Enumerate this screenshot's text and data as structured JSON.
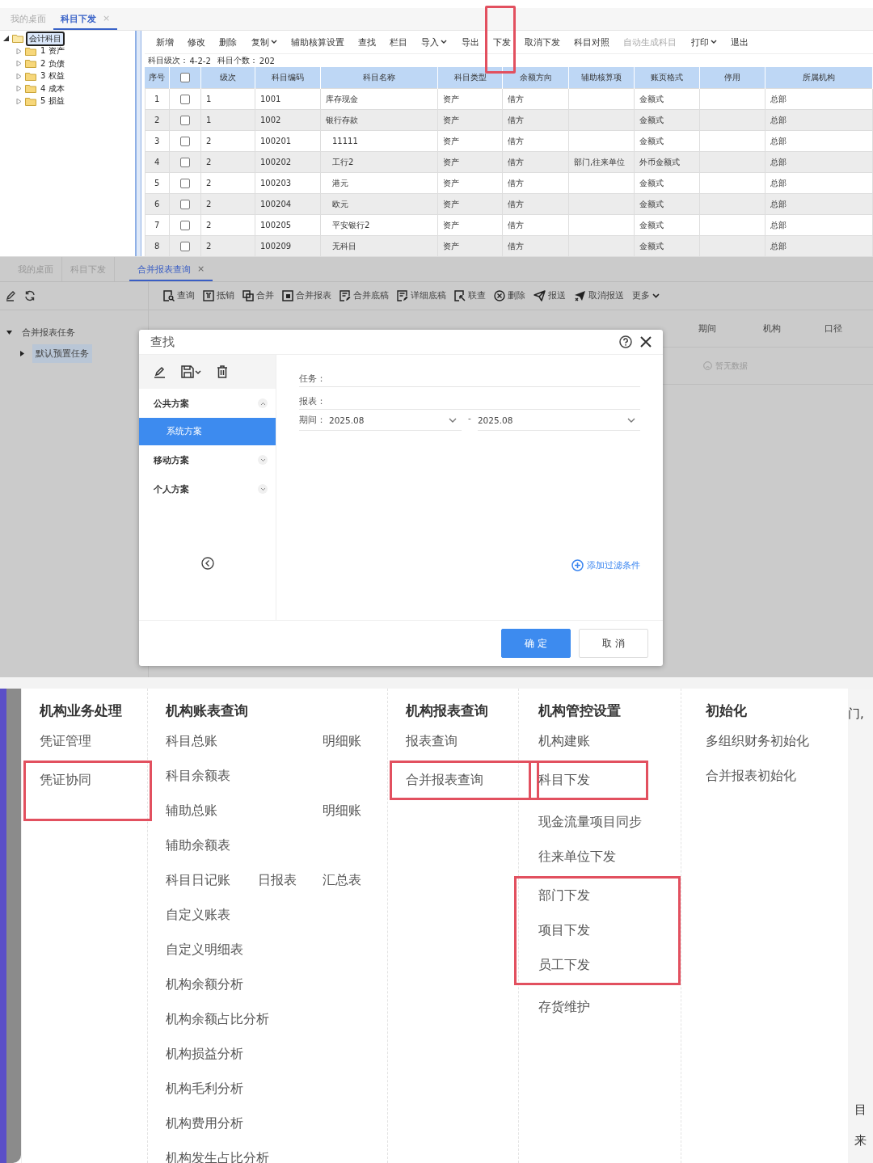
{
  "subject_issue_screen": {
    "tabs": [
      {
        "label": "我的桌面",
        "selected": false,
        "closable": false
      },
      {
        "label": "科目下发",
        "selected": true,
        "closable": true
      }
    ],
    "close_mark": "×",
    "tree": {
      "label": "会计科目",
      "expanded": true,
      "selected": true,
      "children": [
        {
          "label": "1 资产",
          "expanded": false
        },
        {
          "label": "2 负债",
          "expanded": false
        },
        {
          "label": "3 权益",
          "expanded": false
        },
        {
          "label": "4 成本",
          "expanded": false
        },
        {
          "label": "5 损益",
          "expanded": false
        }
      ]
    },
    "toolbar": [
      {
        "label": "新增",
        "dropdown": false,
        "disabled": false,
        "highlighted": false
      },
      {
        "label": "修改",
        "dropdown": false,
        "disabled": false,
        "highlighted": false
      },
      {
        "label": "删除",
        "dropdown": false,
        "disabled": false,
        "highlighted": false
      },
      {
        "label": "复制",
        "dropdown": true,
        "disabled": false,
        "highlighted": false
      },
      {
        "label": "辅助核算设置",
        "dropdown": false,
        "disabled": false,
        "highlighted": false
      },
      {
        "label": "查找",
        "dropdown": false,
        "disabled": false,
        "highlighted": false
      },
      {
        "label": "栏目",
        "dropdown": false,
        "disabled": false,
        "highlighted": false
      },
      {
        "label": "导入",
        "dropdown": true,
        "disabled": false,
        "highlighted": false
      },
      {
        "label": "导出",
        "dropdown": false,
        "disabled": false,
        "highlighted": false
      },
      {
        "label": "下发",
        "dropdown": false,
        "disabled": false,
        "highlighted": true
      },
      {
        "label": "取消下发",
        "dropdown": false,
        "disabled": false,
        "highlighted": false
      },
      {
        "label": "科目对照",
        "dropdown": false,
        "disabled": false,
        "highlighted": false
      },
      {
        "label": "自动生成科目",
        "dropdown": false,
        "disabled": true,
        "highlighted": false
      },
      {
        "label": "打印",
        "dropdown": true,
        "disabled": false,
        "highlighted": false
      },
      {
        "label": "退出",
        "dropdown": false,
        "disabled": false,
        "highlighted": false
      }
    ],
    "summary": [
      {
        "label": "科目级次：",
        "value": "4-2-2"
      },
      {
        "label": "科目个数：",
        "value": "202"
      }
    ],
    "table": {
      "columns": {
        "seq": "序号",
        "grade": "级次",
        "code": "科目编码",
        "name": "科目名称",
        "type": "科目类型",
        "direction": "余额方向",
        "aux": "辅助核算项",
        "format": "账页格式",
        "stopped": "停用",
        "org": "所属机构"
      },
      "all_checked": false,
      "rows": [
        {
          "seq": "1",
          "checked": false,
          "grade": "1",
          "code": "1001",
          "name": "库存现金",
          "type": "资产",
          "direction": "借方",
          "format": "金额式",
          "org": "总部"
        },
        {
          "seq": "2",
          "checked": false,
          "grade": "1",
          "code": "1002",
          "name": "银行存款",
          "type": "资产",
          "direction": "借方",
          "format": "金额式",
          "org": "总部"
        },
        {
          "seq": "3",
          "checked": false,
          "grade": "2",
          "code": "100201",
          "name": "11111",
          "type": "资产",
          "direction": "借方",
          "format": "金额式",
          "org": "总部"
        },
        {
          "seq": "4",
          "checked": false,
          "grade": "2",
          "code": "100202",
          "name": "工行2",
          "type": "资产",
          "direction": "借方",
          "aux": "部门,往来单位",
          "format": "外币金额式",
          "org": "总部"
        },
        {
          "seq": "5",
          "checked": false,
          "grade": "2",
          "code": "100203",
          "name": "港元",
          "type": "资产",
          "direction": "借方",
          "format": "金额式",
          "org": "总部"
        },
        {
          "seq": "6",
          "checked": false,
          "grade": "2",
          "code": "100204",
          "name": "欧元",
          "type": "资产",
          "direction": "借方",
          "format": "金额式",
          "org": "总部"
        },
        {
          "seq": "7",
          "checked": false,
          "grade": "2",
          "code": "100205",
          "name": "平安银行2",
          "type": "资产",
          "direction": "借方",
          "format": "金额式",
          "org": "总部"
        },
        {
          "seq": "8",
          "checked": false,
          "grade": "2",
          "code": "100209",
          "name": "无科目",
          "type": "资产",
          "direction": "借方",
          "format": "金额式",
          "org": "总部"
        }
      ]
    }
  },
  "consolidated_report_screen": {
    "tabs": [
      {
        "label": "我的桌面",
        "selected": false,
        "closable": false
      },
      {
        "label": "科目下发",
        "selected": false,
        "closable": false
      },
      {
        "label": "合并报表查询",
        "selected": true,
        "closable": true
      }
    ],
    "close_mark": "×",
    "tree": {
      "label": "合并报表任务",
      "expanded": true,
      "children": [
        {
          "label": "默认预置任务",
          "expanded": false,
          "selected": true
        }
      ]
    },
    "toolbar": [
      {
        "label": "查询",
        "kind": "query"
      },
      {
        "label": "抵销",
        "kind": "offset"
      },
      {
        "label": "合并",
        "kind": "merge"
      },
      {
        "label": "合并报表",
        "kind": "report"
      },
      {
        "label": "合并底稿",
        "kind": "draft"
      },
      {
        "label": "详细底稿",
        "kind": "draft"
      },
      {
        "label": "联查",
        "kind": "linked"
      },
      {
        "label": "删除",
        "kind": "delete"
      },
      {
        "label": "报送",
        "kind": "send"
      },
      {
        "label": "取消报送",
        "kind": "unsend"
      },
      {
        "label": "更多",
        "kind": "more"
      }
    ],
    "table": {
      "columns": [
        "期间",
        "机构",
        "口径"
      ],
      "empty_text": "暂无数据"
    },
    "dialog": {
      "title": "查找",
      "schemes": [
        {
          "label": "公共方案",
          "expanded": true,
          "children": [
            {
              "label": "系统方案",
              "selected": true
            }
          ]
        },
        {
          "label": "移动方案",
          "expanded": false
        },
        {
          "label": "个人方案",
          "expanded": false
        }
      ],
      "fields": [
        {
          "kind": "text",
          "label": "任务："
        },
        {
          "kind": "text",
          "label": "报表："
        },
        {
          "kind": "range",
          "label": "期间：",
          "from": "2025.08",
          "separator": "-",
          "to": "2025.08"
        }
      ],
      "add_filter": "添加过滤条件",
      "buttons": [
        {
          "label": "确 定",
          "primary": true
        },
        {
          "label": "取 消",
          "primary": false
        }
      ]
    }
  },
  "org_menu": {
    "columns": [
      {
        "title": "机构业务处理",
        "groups": [
          {
            "highlighted": false,
            "rows": [
              [
                "凭证管理"
              ]
            ]
          },
          {
            "highlighted": true,
            "rows": [
              [
                "凭证协同"
              ]
            ]
          }
        ]
      },
      {
        "title": "机构账表查询",
        "groups": [
          {
            "highlighted": false,
            "rows": [
              [
                "科目总账",
                "明细账"
              ],
              [
                "科目余额表"
              ],
              [
                "辅助总账",
                "明细账"
              ],
              [
                "辅助余额表"
              ],
              [
                "科目日记账",
                "日报表",
                "汇总表"
              ],
              [
                "自定义账表"
              ],
              [
                "自定义明细表"
              ],
              [
                "机构余额分析"
              ],
              [
                "机构余额占比分析"
              ],
              [
                "机构损益分析"
              ],
              [
                "机构毛利分析"
              ],
              [
                "机构费用分析"
              ],
              [
                "机构发生占比分析"
              ]
            ]
          }
        ]
      },
      {
        "title": "机构报表查询",
        "groups": [
          {
            "highlighted": false,
            "rows": [
              [
                "报表查询"
              ]
            ]
          },
          {
            "highlighted": true,
            "rows": [
              [
                "合并报表查询"
              ]
            ]
          }
        ]
      },
      {
        "title": "机构管控设置",
        "groups": [
          {
            "highlighted": false,
            "rows": [
              [
                "机构建账"
              ]
            ]
          },
          {
            "highlighted": true,
            "rows": [
              [
                "科目下发"
              ]
            ]
          },
          {
            "highlighted": false,
            "rows": [
              [
                "现金流量项目同步"
              ],
              [
                "往来单位下发"
              ]
            ]
          },
          {
            "highlighted": true,
            "rows": [
              [
                "部门下发"
              ],
              [
                "项目下发"
              ],
              [
                "员工下发"
              ]
            ]
          },
          {
            "highlighted": false,
            "rows": [
              [
                "存货维护"
              ]
            ]
          }
        ]
      },
      {
        "title": "初始化",
        "groups": [
          {
            "highlighted": false,
            "rows": [
              [
                "多组织财务初始化"
              ],
              [
                "合并报表初始化"
              ]
            ]
          }
        ]
      }
    ],
    "background_fragments": [
      "门,",
      "目",
      "来"
    ]
  }
}
